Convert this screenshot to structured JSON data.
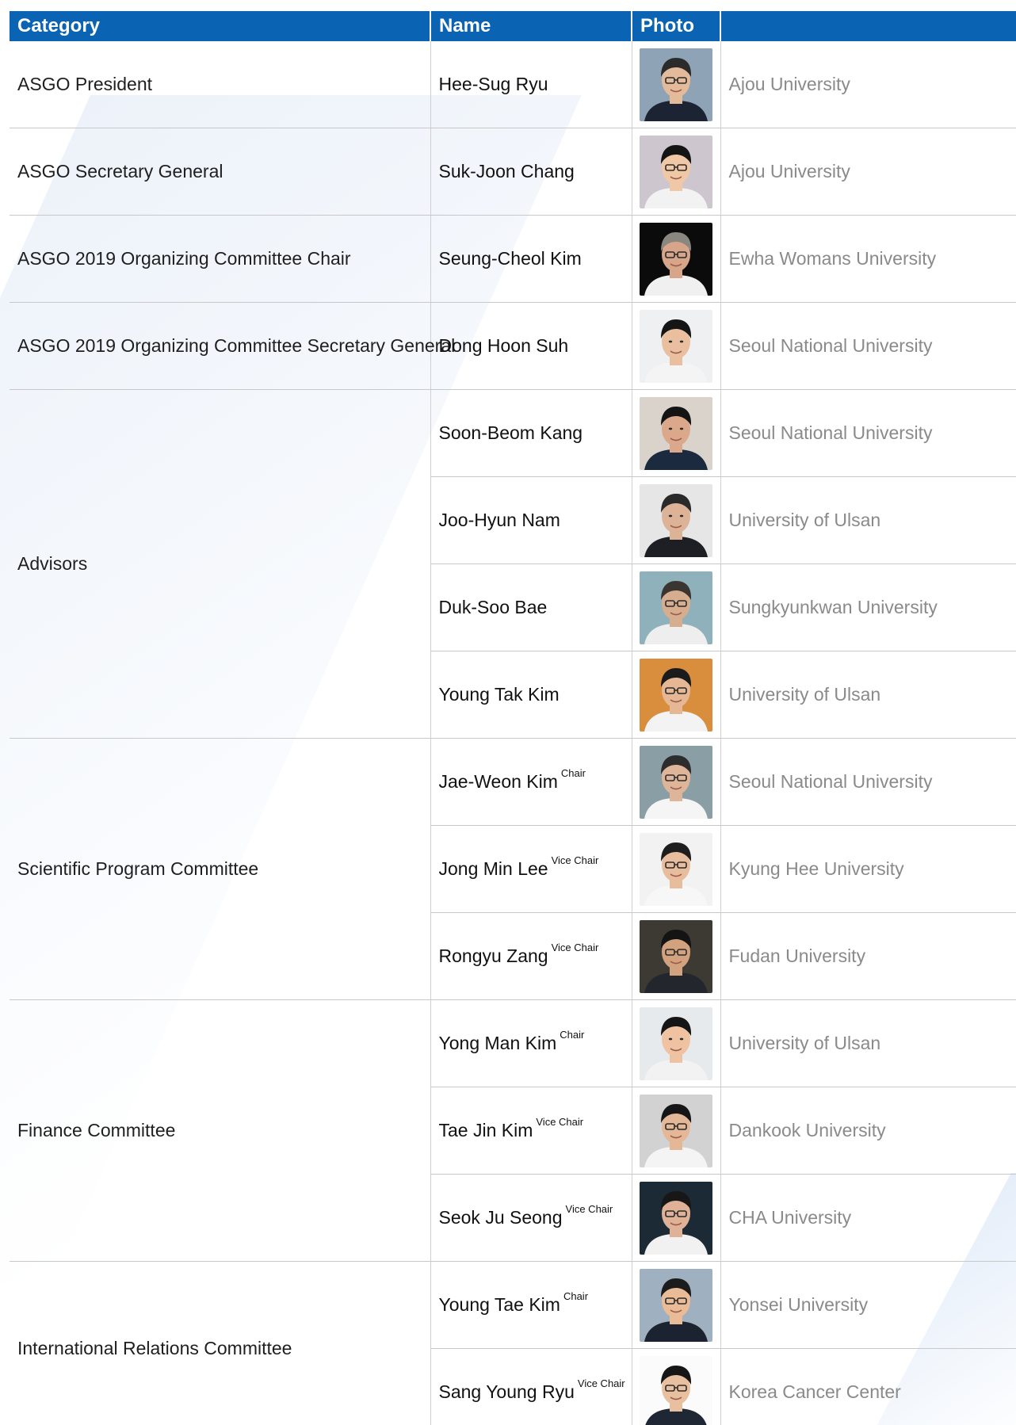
{
  "table": {
    "headers": {
      "category": "Category",
      "name": "Name",
      "photo": "Photo",
      "affiliation": ""
    },
    "groups": [
      {
        "category": "ASGO President",
        "members": [
          {
            "name": "Hee-Sug Ryu",
            "role": "",
            "affiliation": "Ajou University",
            "photo_bg": "#8fa3b7",
            "photo_skin": "#e3ba9a",
            "photo_hair": "#2b2b2b",
            "photo_suit": "#1c2333",
            "photo_glasses": "yes",
            "photo_hair_style": "short"
          }
        ]
      },
      {
        "category": "ASGO Secretary General",
        "members": [
          {
            "name": "Suk-Joon Chang",
            "role": "",
            "affiliation": "Ajou University",
            "photo_bg": "#cec6cf",
            "photo_skin": "#f0c8a6",
            "photo_hair": "#141414",
            "photo_suit": "#f2f2f2",
            "photo_glasses": "yes",
            "photo_hair_style": "short"
          }
        ]
      },
      {
        "category": "ASGO 2019 Organizing Committee Chair",
        "members": [
          {
            "name": "Seung-Cheol Kim",
            "role": "",
            "affiliation": "Ewha Womans University",
            "photo_bg": "#0b0b0b",
            "photo_skin": "#d6a58a",
            "photo_hair": "#8a8680",
            "photo_suit": "#f0f0f0",
            "photo_glasses": "yes",
            "photo_hair_style": "short"
          }
        ]
      },
      {
        "category": "ASGO 2019 Organizing Committee Secretary General",
        "members": [
          {
            "name": "Dong Hoon Suh",
            "role": "",
            "affiliation": "Seoul National University",
            "photo_bg": "#eef0f2",
            "photo_skin": "#e9bf9f",
            "photo_hair": "#151515",
            "photo_suit": "#f4f4f4",
            "photo_glasses": "no",
            "photo_hair_style": "short"
          }
        ]
      },
      {
        "category": "Advisors",
        "members": [
          {
            "name": "Soon-Beom Kang",
            "role": "",
            "affiliation": "Seoul National University",
            "photo_bg": "#d9d3cc",
            "photo_skin": "#dba88c",
            "photo_hair": "#141414",
            "photo_suit": "#1c2a3f",
            "photo_glasses": "no",
            "photo_hair_style": "short"
          },
          {
            "name": "Joo-Hyun Nam",
            "role": "",
            "affiliation": "University of Ulsan",
            "photo_bg": "#e6e6e6",
            "photo_skin": "#dcb397",
            "photo_hair": "#2a2a2a",
            "photo_suit": "#1d1f24",
            "photo_glasses": "no",
            "photo_hair_style": "short"
          },
          {
            "name": "Duk-Soo Bae",
            "role": "",
            "affiliation": "Sungkyunkwan University",
            "photo_bg": "#8fb1bb",
            "photo_skin": "#d7ad90",
            "photo_hair": "#3a3530",
            "photo_suit": "#eeeeee",
            "photo_glasses": "yes",
            "photo_hair_style": "short"
          },
          {
            "name": "Young Tak Kim",
            "role": "",
            "affiliation": "University of Ulsan",
            "photo_bg": "#d98e3e",
            "photo_skin": "#e5b795",
            "photo_hair": "#1b1b1b",
            "photo_suit": "#f3f3f3",
            "photo_glasses": "yes",
            "photo_hair_style": "short"
          }
        ]
      },
      {
        "category": "Scientific Program Committee",
        "members": [
          {
            "name": "Jae-Weon Kim",
            "role": "Chair",
            "affiliation": "Seoul National University",
            "photo_bg": "#8a9ea6",
            "photo_skin": "#dfb59a",
            "photo_hair": "#2c2c2c",
            "photo_suit": "#f5f5f5",
            "photo_glasses": "yes",
            "photo_hair_style": "short"
          },
          {
            "name": "Jong Min Lee",
            "role": "Vice Chair",
            "affiliation": "Kyung Hee University",
            "photo_bg": "#f2f2f2",
            "photo_skin": "#e8bd9d",
            "photo_hair": "#1e1e1e",
            "photo_suit": "#f7f7f7",
            "photo_glasses": "yes",
            "photo_hair_style": "short"
          },
          {
            "name": "Rongyu Zang",
            "role": "Vice Chair",
            "affiliation": "Fudan University",
            "photo_bg": "#3d3a33",
            "photo_skin": "#d2a27e",
            "photo_hair": "#141414",
            "photo_suit": "#23262c",
            "photo_glasses": "yes",
            "photo_hair_style": "short"
          }
        ]
      },
      {
        "category": "Finance Committee",
        "members": [
          {
            "name": "Yong Man Kim",
            "role": "Chair",
            "affiliation": "University of Ulsan",
            "photo_bg": "#e7eaed",
            "photo_skin": "#efc2a2",
            "photo_hair": "#151515",
            "photo_suit": "#f2f2f2",
            "photo_glasses": "no",
            "photo_hair_style": "short"
          },
          {
            "name": "Tae Jin Kim",
            "role": "Vice Chair",
            "affiliation": "Dankook University",
            "photo_bg": "#d2d2d2",
            "photo_skin": "#e4b797",
            "photo_hair": "#161616",
            "photo_suit": "#f4f4f4",
            "photo_glasses": "yes",
            "photo_hair_style": "short"
          },
          {
            "name": "Seok Ju Seong",
            "role": "Vice Chair",
            "affiliation": "CHA University",
            "photo_bg": "#1c2a35",
            "photo_skin": "#dfb196",
            "photo_hair": "#171717",
            "photo_suit": "#f1f1f1",
            "photo_glasses": "yes",
            "photo_hair_style": "short"
          }
        ]
      },
      {
        "category": "International Relations Committee",
        "members": [
          {
            "name": "Young Tae Kim",
            "role": "Chair",
            "affiliation": "Yonsei University",
            "photo_bg": "#9fb0c0",
            "photo_skin": "#e9bb97",
            "photo_hair": "#1c1c1c",
            "photo_suit": "#1b2331",
            "photo_glasses": "yes",
            "photo_hair_style": "short"
          },
          {
            "name": "Sang Young Ryu",
            "role": "Vice Chair",
            "affiliation": "Korea Cancer Center",
            "photo_bg": "#fbfbfb",
            "photo_skin": "#e8c0a0",
            "photo_hair": "#161616",
            "photo_suit": "#1f2734",
            "photo_glasses": "yes",
            "photo_hair_style": "short"
          }
        ]
      }
    ]
  }
}
